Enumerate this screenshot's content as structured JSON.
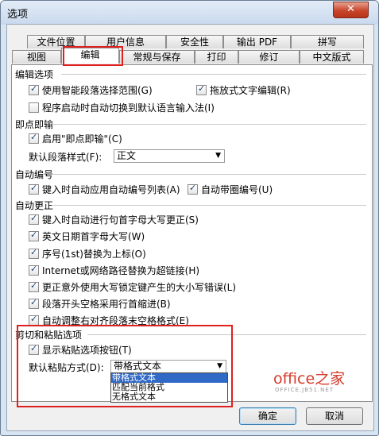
{
  "window": {
    "title": "选项",
    "close_glyph": "✕"
  },
  "tabs": {
    "back_row": [
      "文件位置",
      "用户信息",
      "安全性",
      "输出 PDF",
      "拼写"
    ],
    "front_row": [
      "视图",
      "编辑",
      "常规与保存",
      "打印",
      "修订",
      "中文版式"
    ],
    "active": "编辑"
  },
  "sections": {
    "edit": {
      "title": "编辑选项",
      "smart_select": "使用智能段落选择范围(G)",
      "drag_drop": "拖放式文字编辑(R)",
      "auto_switch_lang": "程序启动时自动切换到默认语言输入法(I)"
    },
    "click_and_type": {
      "title": "即点即输",
      "enable": "启用\"即点即输\"(C)",
      "default_style_label": "默认段落样式(F):",
      "default_style_value": "正文"
    },
    "auto_number": {
      "title": "自动编号",
      "apply_list": "键入时自动应用自动编号列表(A)",
      "circle_number": "自动带圈编号(U)"
    },
    "autocorrect": {
      "title": "自动更正",
      "items": [
        "键入时自动进行句首字母大写更正(S)",
        "英文日期首字母大写(W)",
        "序号(1st)替换为上标(O)",
        "Internet或网络路径替换为超链接(H)",
        "更正意外使用大写锁定键产生的大小写错误(L)",
        "段落开头空格采用行首缩进(B)",
        "自动调整右对齐段落末空格格式(E)"
      ]
    },
    "paste": {
      "title": "剪切和粘贴选项",
      "show_button": "显示粘贴选项按钮(T)",
      "default_label": "默认粘贴方式(D):",
      "default_value": "带格式文本",
      "options": [
        "带格式文本",
        "匹配当前格式",
        "无格式文本"
      ],
      "selected_option": "带格式文本"
    }
  },
  "buttons": {
    "ok": "确定",
    "cancel": "取消"
  },
  "watermark": {
    "brand": "office之家",
    "url": "OFFICE.JB51.NET"
  },
  "colors": {
    "highlight": "#e01f1f",
    "selection": "#3169c6",
    "watermark": "#d63a2a"
  }
}
